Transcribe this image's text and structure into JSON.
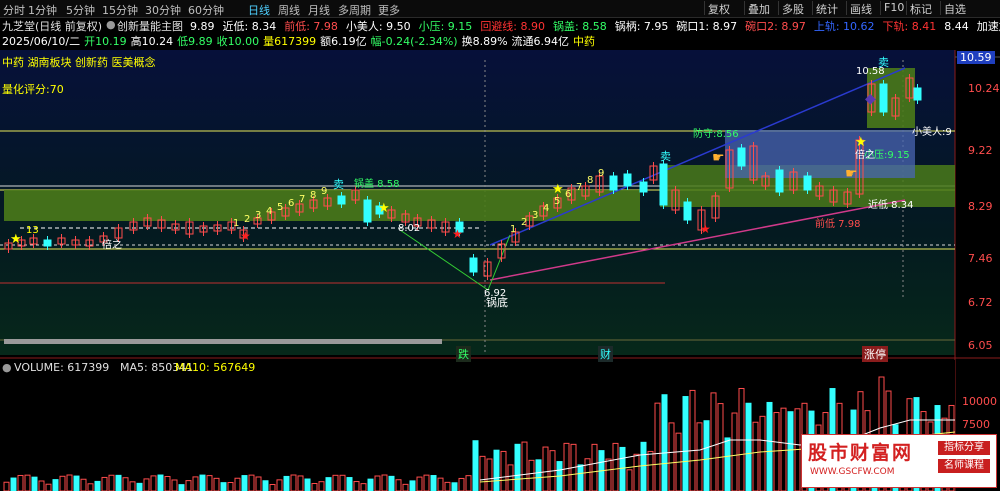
{
  "toolbar": {
    "periods": [
      "分时",
      "1分钟",
      "5分钟",
      "15分钟",
      "30分钟",
      "60分钟",
      "日线",
      "周线",
      "月线",
      "多周期",
      "更多"
    ],
    "active_period": "日线",
    "right_buttons": [
      "复权",
      "叠加",
      "多股",
      "统计",
      "画线",
      "F10",
      "标记",
      "自选"
    ]
  },
  "header": {
    "title": "九芝堂(日线 前复权)",
    "indicator": "创新量能主图",
    "stats": [
      {
        "label": "9.89",
        "color": "#ffffff"
      },
      {
        "label": "近低: 8.34",
        "color": "#ffffff"
      },
      {
        "label": "前低: 7.98",
        "color": "#ff4d4d"
      },
      {
        "label": "小美人: 9.50",
        "color": "#ffffff"
      },
      {
        "label": "小压: 9.15",
        "color": "#33ff66"
      },
      {
        "label": "回避线: 8.90",
        "color": "#ff3333"
      },
      {
        "label": "锅盖: 8.58",
        "color": "#33ff66"
      },
      {
        "label": "锅柄: 7.95",
        "color": "#ffffff"
      },
      {
        "label": "碗口1: 8.97",
        "color": "#ffffff"
      },
      {
        "label": "碗口2: 8.97",
        "color": "#ff4d4d"
      },
      {
        "label": "上轨: 10.62",
        "color": "#3366ff"
      },
      {
        "label": "下轨: 8.41",
        "color": "#ff3333"
      },
      {
        "label": "8.44",
        "color": "#ffffff"
      },
      {
        "label": "加速加仓:",
        "color": "#ffffff"
      }
    ],
    "quote": [
      {
        "text": "2025/06/10/二",
        "color": "#ffffff"
      },
      {
        "text": "开10.19",
        "color": "#33ff66"
      },
      {
        "text": "高10.24",
        "color": "#ffffff"
      },
      {
        "text": "低9.89",
        "color": "#33ff66"
      },
      {
        "text": "收10.00",
        "color": "#33ff66"
      },
      {
        "text": "量617399",
        "color": "#ffff00"
      },
      {
        "text": "额6.19亿",
        "color": "#ffffff"
      },
      {
        "text": "幅-0.24(-2.34%)",
        "color": "#33ff66"
      },
      {
        "text": "换8.89%",
        "color": "#ffffff"
      },
      {
        "text": "流通6.94亿",
        "color": "#ffffff"
      },
      {
        "text": "中药",
        "color": "#ffff00"
      }
    ],
    "concepts": "中药 湖南板块 创新药 医美概念",
    "score": "量化评分:70"
  },
  "price_axis": {
    "ticks": [
      "10.59",
      "10.24",
      "9.22",
      "8.29",
      "7.46",
      "6.72",
      "6.05"
    ],
    "current": "10.59"
  },
  "volume_panel": {
    "label": "VOLUME: 617399",
    "ma5": "MA5: 850341",
    "ma10": "MA10: 567649",
    "ticks": [
      "10000",
      "7500"
    ]
  },
  "markers": {
    "bottom_tags": [
      "跌",
      "财",
      "涨停"
    ],
    "annotations": {
      "low_price": "6.92",
      "guodi": "锅底",
      "guogai": "锅盖 8.58",
      "fangshou": "防守:8.56",
      "xiaoyarei": "小压:9.15",
      "jindi": "近低 8.34",
      "qiandi": "前低 7.98",
      "beizhi": "倍之",
      "xiaomeiren": "小美人:9",
      "sell": "卖",
      "top_price": "10.58",
      "val_802": "8.02",
      "nums_left": [
        "13",
        "1",
        "2",
        "3",
        "4",
        "5",
        "6",
        "7",
        "8",
        "9"
      ],
      "nums_mid": [
        "1",
        "2",
        "3",
        "4",
        "5",
        "6",
        "7",
        "8",
        "9"
      ]
    }
  },
  "watermark": {
    "title": "股市财富网",
    "url": "WWW.GSCFW.COM",
    "tag1": "指标分享",
    "tag2": "名师课程"
  },
  "colors": {
    "up": "#ff4d4d",
    "down": "#33ffff",
    "green_zone": "#4a7a1a",
    "blue_zone": "#4a66b3",
    "grid_yellow": "#e8e85a"
  }
}
